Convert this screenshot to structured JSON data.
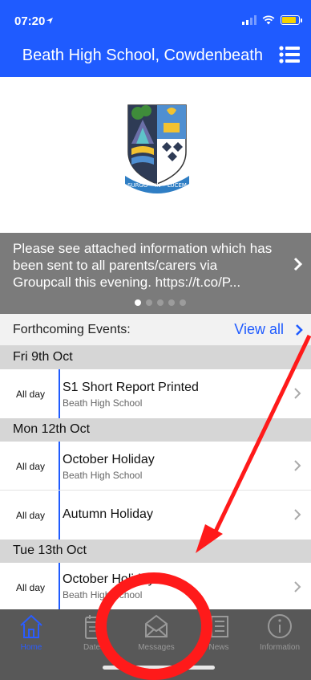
{
  "status": {
    "time": "07:20",
    "battery_color": "#f6d200"
  },
  "header": {
    "title": "Beath High School, Cowdenbeath",
    "menu_icon": "list-menu-icon",
    "bg_color": "#1f5bff"
  },
  "crest": {
    "motto": "SURGO • IN • LUCEM"
  },
  "announcement": {
    "text": "Please see attached information which has been sent to all parents/carers via Groupcall this evening. https://t.co/P...",
    "page_count": 5,
    "active_index": 0
  },
  "events": {
    "title": "Forthcoming Events:",
    "view_all": "View all",
    "days": [
      {
        "date": "Fri 9th Oct",
        "items": [
          {
            "time": "All day",
            "title": "S1 Short Report Printed",
            "subtitle": "Beath High School"
          }
        ]
      },
      {
        "date": "Mon 12th Oct",
        "items": [
          {
            "time": "All day",
            "title": "October Holiday",
            "subtitle": "Beath High School"
          },
          {
            "time": "All day",
            "title": "Autumn Holiday",
            "subtitle": ""
          }
        ]
      },
      {
        "date": "Tue 13th Oct",
        "items": [
          {
            "time": "All day",
            "title": "October Holiday",
            "subtitle": "Beath High School"
          }
        ]
      }
    ]
  },
  "tabs": [
    {
      "label": "Home",
      "icon": "home-icon",
      "active": true
    },
    {
      "label": "Dates",
      "icon": "calendar-icon",
      "active": false
    },
    {
      "label": "Messages",
      "icon": "envelope-icon",
      "active": false
    },
    {
      "label": "News",
      "icon": "newspaper-icon",
      "active": false
    },
    {
      "label": "Information",
      "icon": "info-icon",
      "active": false
    }
  ],
  "annotations": {
    "color": "#ff1a1a"
  }
}
